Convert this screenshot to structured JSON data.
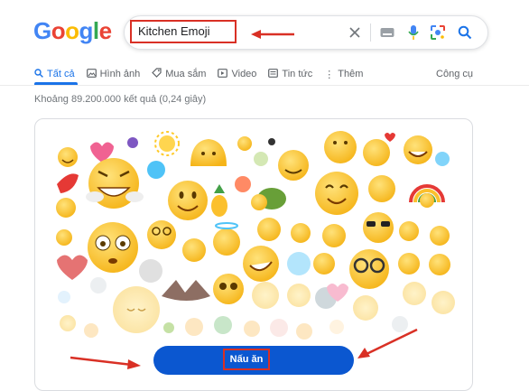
{
  "logo": {
    "letters": [
      "G",
      "o",
      "o",
      "g",
      "l",
      "e"
    ],
    "colors": [
      "#4285f4",
      "#ea4335",
      "#fbbc05",
      "#4285f4",
      "#34a853",
      "#ea4335"
    ]
  },
  "search": {
    "query": "Kitchen Emoji"
  },
  "tabs": [
    {
      "label": "Tất cả",
      "icon": "search-icon",
      "glyph": "🔍"
    },
    {
      "label": "Hình ảnh",
      "icon": "image-icon",
      "glyph": "🖼"
    },
    {
      "label": "Mua sắm",
      "icon": "tag-icon",
      "glyph": "◇"
    },
    {
      "label": "Video",
      "icon": "play-icon",
      "glyph": "▷"
    },
    {
      "label": "Tin tức",
      "icon": "news-icon",
      "glyph": "▤"
    },
    {
      "label": "Thêm",
      "icon": "more-vert-icon",
      "glyph": "⋮"
    }
  ],
  "tools_label": "Công cụ",
  "result_stats": "Khoảng 89.200.000 kết quả (0,24 giây)",
  "cook_button": {
    "label": "Nấu ăn"
  },
  "colors": {
    "accent": "#1a73e8",
    "button": "#0b57d0",
    "annotation": "#d93025"
  }
}
